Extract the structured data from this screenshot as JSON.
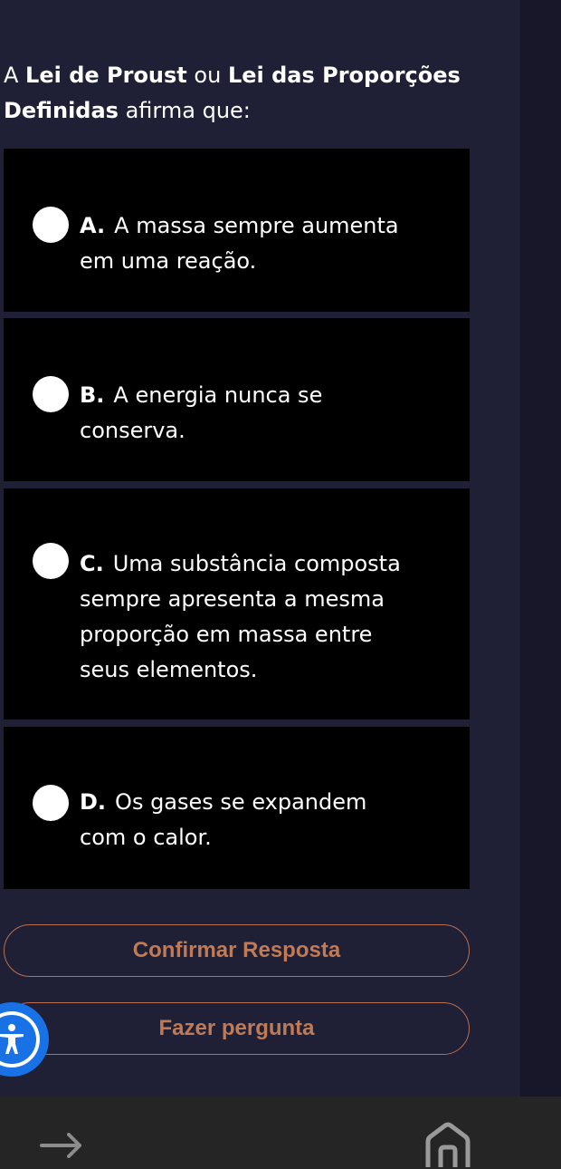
{
  "question": {
    "text_bold": "Lei de Proust",
    "text_prefix": "A ",
    "text_mid": " ou ",
    "text_bold2": "Lei das Proporções Definidas",
    "text_suffix": " afirma que:"
  },
  "options": [
    {
      "letter": "A.",
      "text": "A massa sempre aumenta em uma reação."
    },
    {
      "letter": "B.",
      "text": "A energia nunca se conserva."
    },
    {
      "letter": "C.",
      "text": "Uma substância composta sempre apresenta a mesma proporção em massa entre seus elementos."
    },
    {
      "letter": "D.",
      "text": "Os gases se expandem com o calor."
    }
  ],
  "buttons": {
    "confirm_label": "Confirmar Resposta",
    "ask_label": "Fazer pergunta"
  },
  "icons": {
    "accessibility": "accessibility-icon",
    "forward": "arrow-right-icon",
    "home": "home-icon"
  },
  "colors": {
    "background": "#1f1f36",
    "option_bg": "#000000",
    "button_border": "#b8704e",
    "button_text": "#c07a55",
    "accessibility_blue": "#1872e6"
  }
}
